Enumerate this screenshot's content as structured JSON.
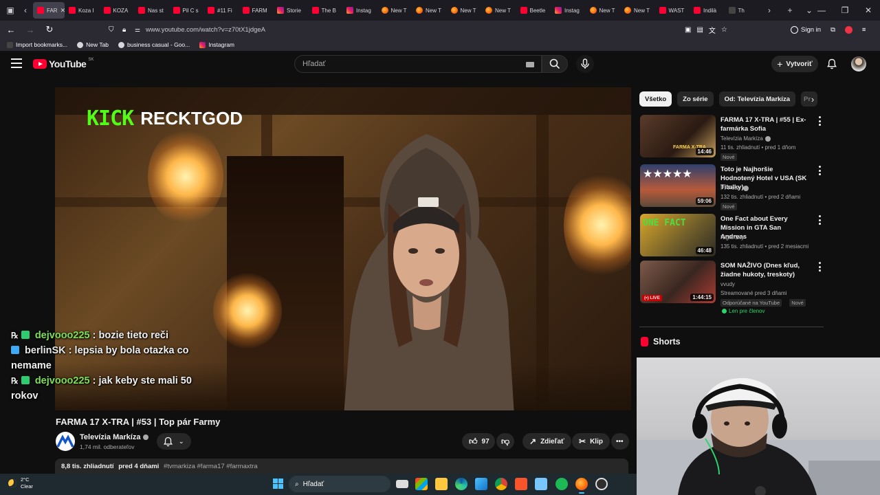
{
  "browser": {
    "tabs": [
      {
        "label": "FAR",
        "icon": "youtube",
        "active": true
      },
      {
        "label": "Koza I",
        "icon": "youtube"
      },
      {
        "label": "KOZA",
        "icon": "youtube"
      },
      {
        "label": "Nas st",
        "icon": "youtube"
      },
      {
        "label": "Pil C s",
        "icon": "youtube"
      },
      {
        "label": "#11 Fi",
        "icon": "youtube"
      },
      {
        "label": "FARM",
        "icon": "youtube"
      },
      {
        "label": "Storie",
        "icon": "instagram"
      },
      {
        "label": "The B",
        "icon": "youtube"
      },
      {
        "label": "Instag",
        "icon": "instagram"
      },
      {
        "label": "New T",
        "icon": "firefox"
      },
      {
        "label": "New T",
        "icon": "firefox"
      },
      {
        "label": "New T",
        "icon": "firefox"
      },
      {
        "label": "New T",
        "icon": "firefox"
      },
      {
        "label": "Beetle",
        "icon": "youtube"
      },
      {
        "label": "Instag",
        "icon": "instagram"
      },
      {
        "label": "New T",
        "icon": "firefox"
      },
      {
        "label": "New T",
        "icon": "firefox"
      },
      {
        "label": "WAST",
        "icon": "youtube"
      },
      {
        "label": "Indilà",
        "icon": "youtube"
      },
      {
        "label": "Th",
        "icon": "tiktok"
      }
    ],
    "url": "www.youtube.com/watch?v=z70tX1jdgeA",
    "sign_in": "Sign in",
    "bookmarks": [
      {
        "label": "Import bookmarks...",
        "icon": "import"
      },
      {
        "label": "New Tab",
        "icon": "globe"
      },
      {
        "label": "business casual - Goo...",
        "icon": "google"
      },
      {
        "label": "Instagram",
        "icon": "instagram"
      }
    ]
  },
  "youtube": {
    "logo_text": "YouTube",
    "region": "SK",
    "search_placeholder": "Hľadať",
    "create_label": "Vytvoriť"
  },
  "video": {
    "overlay_logo": "KICK",
    "overlay_name": "RECKTGOD",
    "chat": [
      {
        "user": "dejvooo225",
        "text": ": bozie tieto reči"
      },
      {
        "user": "berlinSK",
        "text": ": lepsia by bola otazka co nemame"
      },
      {
        "user": "dejvooo225",
        "text": ": jak keby ste mali 50 rokov"
      }
    ],
    "title": "FARMA 17 X-TRA | #53 | Top pár Farmy",
    "channel": "Televízia Markíza",
    "subscribers": "1,74 mil. odberateľov",
    "likes": "97",
    "share_label": "Zdieľať",
    "clip_label": "Klip",
    "views": "8,8 tis. zhliadnutí",
    "age": "pred 4 dňami",
    "hashtags": "#tvmarkiza #farma17 #farmaxtra"
  },
  "sidebar": {
    "chips": [
      "Všetko",
      "Zo série",
      "Od: Televízia Markíza",
      "Pr"
    ],
    "recommendations": [
      {
        "title": "FARMA 17 X-TRA | #55 | Ex-farmárka Sofia",
        "channel": "Televízia Markíza",
        "verified": true,
        "meta": "11 tis. zhliadnutí • pred 1 dňom",
        "badges": [
          "Nové"
        ],
        "duration": "14:46",
        "thumb_text": "FARMA X-TRA"
      },
      {
        "title": "Toto je Najhoršie Hodnotený Hotel v USA (SK Titulky)",
        "channel": "PPPeter",
        "verified": true,
        "meta": "132 tis. zhliadnutí • pred 2 dňami",
        "badges": [
          "Nové"
        ],
        "duration": "59:06"
      },
      {
        "title": "One Fact about Every Mission in GTA San Andreas",
        "channel": "Night Sky",
        "verified": false,
        "meta": "135 tis. zhliadnutí • pred 2 mesiacmi",
        "badges": [],
        "duration": "46:48",
        "thumb_text": "ONE FACT"
      },
      {
        "title": "SOM NAŽIVO (Dnes kľud, žiadne hukoty, treskoty)",
        "channel": "vvudy",
        "verified": false,
        "meta": "Streamované pred 3 dňami",
        "badges": [
          "Odporúčané na YouTube",
          "Nové"
        ],
        "members_label": "Len pre členov",
        "duration": "1:44:15",
        "live_label": "(•) LIVE"
      }
    ],
    "shorts_label": "Shorts"
  },
  "taskbar": {
    "temperature": "2°C",
    "condition": "Clear",
    "search_label": "Hľadať"
  },
  "colors": {
    "youtube_red": "#ff0033",
    "kick_green": "#53fc18",
    "chat_name_green": "#7ee05a",
    "windows_accent": "#4cc2ff"
  }
}
